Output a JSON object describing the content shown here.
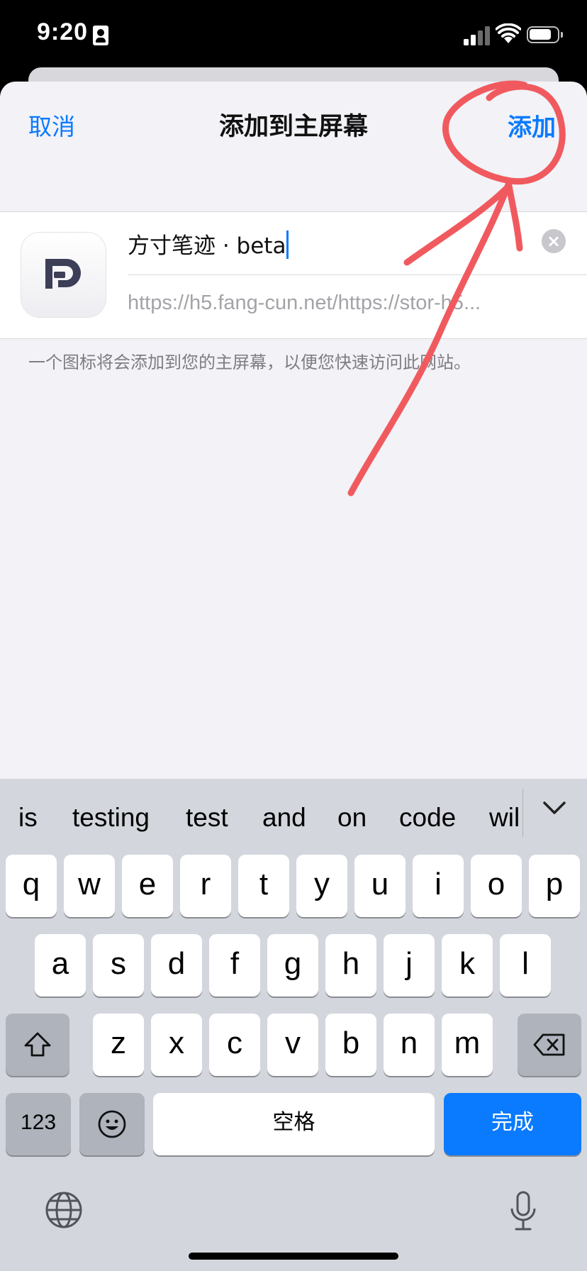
{
  "status_bar": {
    "time": "9:20"
  },
  "sheet": {
    "cancel_label": "取消",
    "title": "添加到主屏幕",
    "add_label": "添加"
  },
  "bookmark": {
    "name_value": "方寸笔迹 · beta",
    "url": "https://h5.fang-cun.net/https://stor-h5...",
    "description": "一个图标将会添加到您的主屏幕，以便您快速访问此网站。"
  },
  "keyboard": {
    "suggestions": [
      "is",
      "testing",
      "test",
      "and",
      "on",
      "code",
      "wil"
    ],
    "row1": [
      "q",
      "w",
      "e",
      "r",
      "t",
      "y",
      "u",
      "i",
      "o",
      "p"
    ],
    "row2": [
      "a",
      "s",
      "d",
      "f",
      "g",
      "h",
      "j",
      "k",
      "l"
    ],
    "row3": [
      "z",
      "x",
      "c",
      "v",
      "b",
      "n",
      "m"
    ],
    "numbers_label": "123",
    "space_label": "空格",
    "done_label": "完成"
  },
  "colors": {
    "accent": "#0a7aff",
    "annotation": "#f05a5e"
  }
}
